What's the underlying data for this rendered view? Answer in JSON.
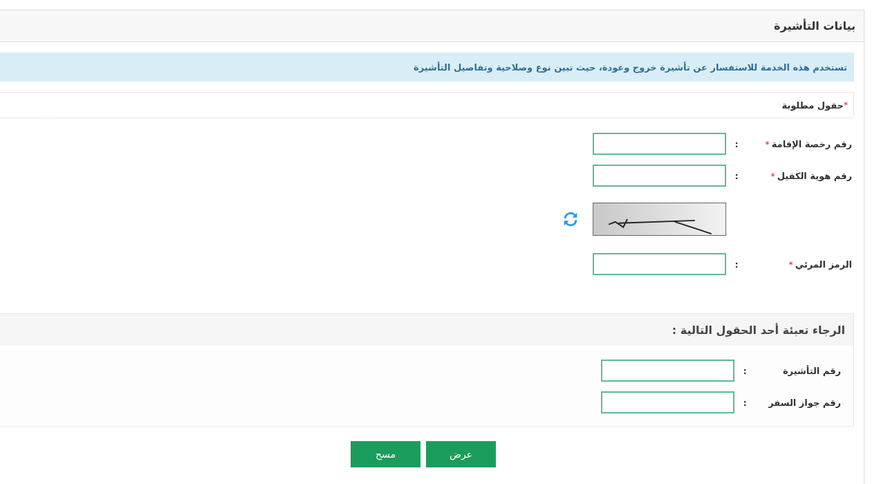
{
  "panel": {
    "title": "بيانات التأشيرة"
  },
  "info": "تستخدم هذه الخدمة للاستفسار عن تأشيرة خروج وعودة، حيث تبين نوع وصلاحية وتفاصيل التأشيرة",
  "required_note": {
    "mark": "*",
    "text": "حقول مطلوبة"
  },
  "fields": [
    {
      "kind": "input",
      "label": "رقم رخصة الإقامة",
      "mark": "*",
      "separator": ":"
    },
    {
      "kind": "input",
      "label": "رقم هوية الكفيل",
      "mark": "*",
      "separator": ":"
    },
    {
      "kind": "captcha"
    },
    {
      "kind": "input",
      "label": "الرمز المرئي",
      "mark": "*",
      "separator": ":"
    }
  ],
  "alternative_section": {
    "title": "الرجاء تعبئة أحد الحقول التالية :",
    "fields": [
      {
        "kind": "input",
        "label": "رقم التأشيرة",
        "separator": ":"
      },
      {
        "kind": "input",
        "label": "رقم جواز السفر",
        "separator": ":"
      }
    ]
  },
  "buttons": [
    {
      "label": "عرض"
    },
    {
      "label": "مسح"
    }
  ]
}
